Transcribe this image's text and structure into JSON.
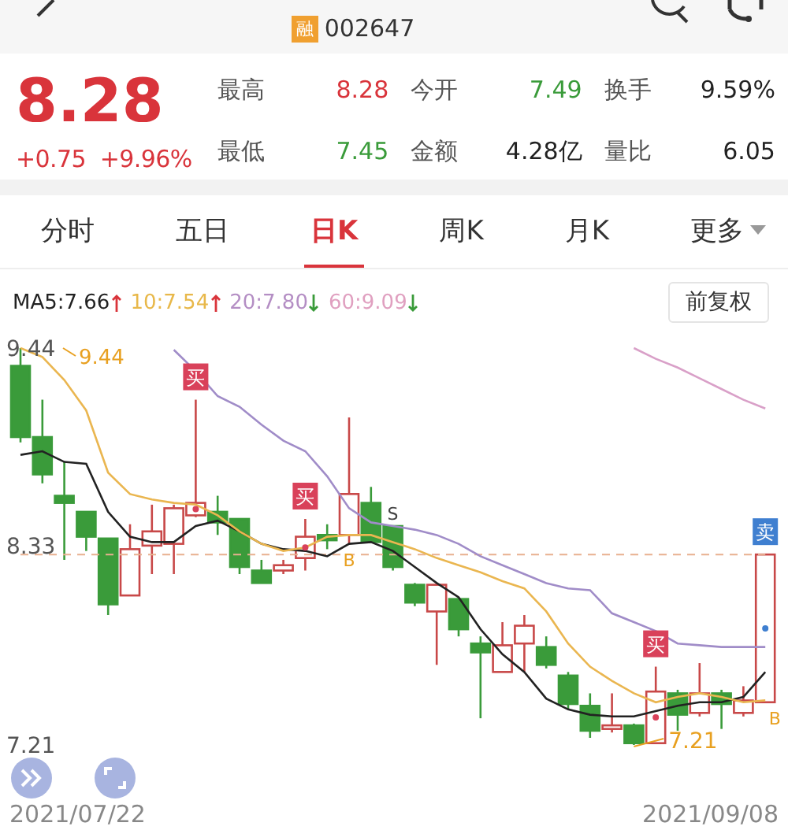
{
  "header": {
    "badge": "融",
    "code": "002647"
  },
  "quote": {
    "price": "8.28",
    "change": "+0.75",
    "change_pct": "+9.96%",
    "stats": [
      {
        "label": "最高",
        "value": "8.28",
        "color": "#d9343b"
      },
      {
        "label": "今开",
        "value": "7.49",
        "color": "#3a9b3a"
      },
      {
        "label": "换手",
        "value": "9.59%",
        "color": "#222222"
      },
      {
        "label": "最低",
        "value": "7.45",
        "color": "#3a9b3a"
      },
      {
        "label": "金额",
        "value": "4.28亿",
        "color": "#222222"
      },
      {
        "label": "量比",
        "value": "6.05",
        "color": "#222222"
      }
    ]
  },
  "tabs": [
    {
      "label": "分时",
      "selected": false,
      "kind": "tab"
    },
    {
      "label": "五日",
      "selected": false,
      "kind": "tab"
    },
    {
      "label": "日K",
      "selected": true,
      "kind": "tab"
    },
    {
      "label": "周K",
      "selected": false,
      "kind": "tab"
    },
    {
      "label": "月K",
      "selected": false,
      "kind": "tab"
    },
    {
      "label": "更多",
      "selected": false,
      "kind": "menu"
    }
  ],
  "moving_averages": [
    {
      "label": "MA5:7.66",
      "rising": true,
      "color": "#222222"
    },
    {
      "label": "10:7.54",
      "rising": true,
      "color": "#e8b84a"
    },
    {
      "label": "20:7.80",
      "rising": false,
      "color": "#b48ec4"
    },
    {
      "label": "60:9.09",
      "rising": false,
      "color": "#e0a0c0"
    }
  ],
  "adjust_button": "前复权",
  "chart": {
    "high_marker": "9.44",
    "low_marker": "7.21",
    "signals": [
      {
        "kind": "buy",
        "label": "买"
      },
      {
        "kind": "buy",
        "label": "买"
      },
      {
        "kind": "buy",
        "label": "买"
      },
      {
        "kind": "sell",
        "label": "卖"
      }
    ],
    "point_marks": [
      "B",
      "S",
      "B"
    ],
    "dates": [
      "2021/07/22",
      "2021/09/08"
    ],
    "chart_data": {
      "type": "candlestick",
      "ylim": [
        7.21,
        9.44
      ],
      "yticks": [
        9.44,
        8.33,
        7.21
      ],
      "ohlc": [
        [
          9.34,
          9.44,
          8.91,
          8.94
        ],
        [
          8.94,
          9.15,
          8.68,
          8.73
        ],
        [
          8.61,
          8.8,
          8.25,
          8.57
        ],
        [
          8.52,
          8.52,
          8.3,
          8.38
        ],
        [
          8.37,
          8.37,
          7.94,
          8.0
        ],
        [
          8.05,
          8.45,
          8.05,
          8.31
        ],
        [
          8.33,
          8.56,
          8.17,
          8.41
        ],
        [
          8.34,
          8.56,
          8.17,
          8.54
        ],
        [
          8.5,
          9.15,
          8.49,
          8.57
        ],
        [
          8.52,
          8.61,
          8.39,
          8.46
        ],
        [
          8.48,
          8.48,
          8.17,
          8.21
        ],
        [
          8.19,
          8.25,
          8.12,
          8.12
        ],
        [
          8.19,
          8.25,
          8.17,
          8.22
        ],
        [
          8.26,
          8.48,
          8.19,
          8.38
        ],
        [
          8.39,
          8.45,
          8.31,
          8.36
        ],
        [
          8.39,
          9.05,
          8.34,
          8.62
        ],
        [
          8.57,
          8.66,
          8.35,
          8.35
        ],
        [
          8.44,
          8.44,
          8.19,
          8.21
        ],
        [
          8.11,
          8.12,
          7.99,
          8.01
        ],
        [
          7.96,
          8.12,
          7.66,
          8.11
        ],
        [
          8.03,
          8.04,
          7.82,
          7.86
        ],
        [
          7.78,
          7.82,
          7.36,
          7.73
        ],
        [
          7.62,
          7.9,
          7.62,
          7.77
        ],
        [
          7.78,
          7.94,
          7.62,
          7.88
        ],
        [
          7.76,
          7.82,
          7.64,
          7.66
        ],
        [
          7.6,
          7.62,
          7.41,
          7.44
        ],
        [
          7.43,
          7.5,
          7.25,
          7.29
        ],
        [
          7.3,
          7.5,
          7.28,
          7.32
        ],
        [
          7.32,
          7.33,
          7.21,
          7.22
        ],
        [
          7.22,
          7.65,
          7.22,
          7.51
        ],
        [
          7.5,
          7.52,
          7.29,
          7.38
        ],
        [
          7.39,
          7.67,
          7.37,
          7.5
        ],
        [
          7.5,
          7.52,
          7.3,
          7.44
        ],
        [
          7.39,
          7.54,
          7.37,
          7.46
        ],
        [
          7.45,
          8.28,
          7.45,
          8.28
        ]
      ],
      "series": [
        {
          "type": "line",
          "line_style": "dashed",
          "color": "#e8b090",
          "values": [
            8.28,
            8.28,
            8.28,
            8.28,
            8.28,
            8.28,
            8.28,
            8.28,
            8.28,
            8.28,
            8.28,
            8.28,
            8.28,
            8.28,
            8.28,
            8.28,
            8.28,
            8.28,
            8.28,
            8.28,
            8.28,
            8.28,
            8.28,
            8.28,
            8.28,
            8.28,
            8.28,
            8.28,
            8.28,
            8.28,
            8.28,
            8.28,
            8.28,
            8.28,
            8.28
          ]
        },
        {
          "type": "line",
          "color": "#222222",
          "values": [
            8.84,
            8.86,
            8.8,
            8.79,
            8.52,
            8.38,
            8.35,
            8.35,
            8.44,
            8.47,
            8.41,
            8.34,
            8.31,
            8.3,
            8.27,
            8.34,
            8.35,
            8.3,
            8.21,
            8.12,
            8.04,
            7.86,
            7.72,
            7.62,
            7.47,
            7.41,
            7.38,
            7.37,
            7.37,
            7.4,
            7.43,
            7.45,
            7.45,
            7.48,
            7.62
          ]
        },
        {
          "type": "line",
          "color": "#eab650",
          "values": [
            9.44,
            9.39,
            9.26,
            9.09,
            8.74,
            8.62,
            8.59,
            8.57,
            8.56,
            8.5,
            8.41,
            8.34,
            8.3,
            8.32,
            8.38,
            8.39,
            8.39,
            8.35,
            8.31,
            8.26,
            8.22,
            8.18,
            8.13,
            8.09,
            7.96,
            7.78,
            7.65,
            7.57,
            7.5,
            7.45,
            7.48,
            7.5,
            7.48,
            7.45,
            7.46
          ]
        },
        {
          "type": "line",
          "color": "#a08cc8",
          "values": [
            null,
            null,
            null,
            null,
            null,
            null,
            null,
            9.43,
            9.31,
            9.17,
            9.11,
            9.01,
            8.92,
            8.86,
            8.72,
            8.54,
            8.46,
            8.44,
            8.42,
            8.39,
            8.34,
            8.27,
            8.22,
            8.17,
            8.12,
            8.09,
            8.08,
            7.95,
            7.9,
            7.85,
            7.78,
            7.77,
            7.76,
            7.76,
            7.76
          ]
        },
        {
          "type": "line",
          "color": "#d9a0c8",
          "values": [
            null,
            null,
            null,
            null,
            null,
            null,
            null,
            null,
            null,
            null,
            null,
            null,
            null,
            null,
            null,
            null,
            null,
            null,
            null,
            null,
            null,
            null,
            null,
            null,
            null,
            null,
            null,
            null,
            9.44,
            9.38,
            9.33,
            9.27,
            9.21,
            9.15,
            9.1
          ]
        }
      ]
    }
  }
}
